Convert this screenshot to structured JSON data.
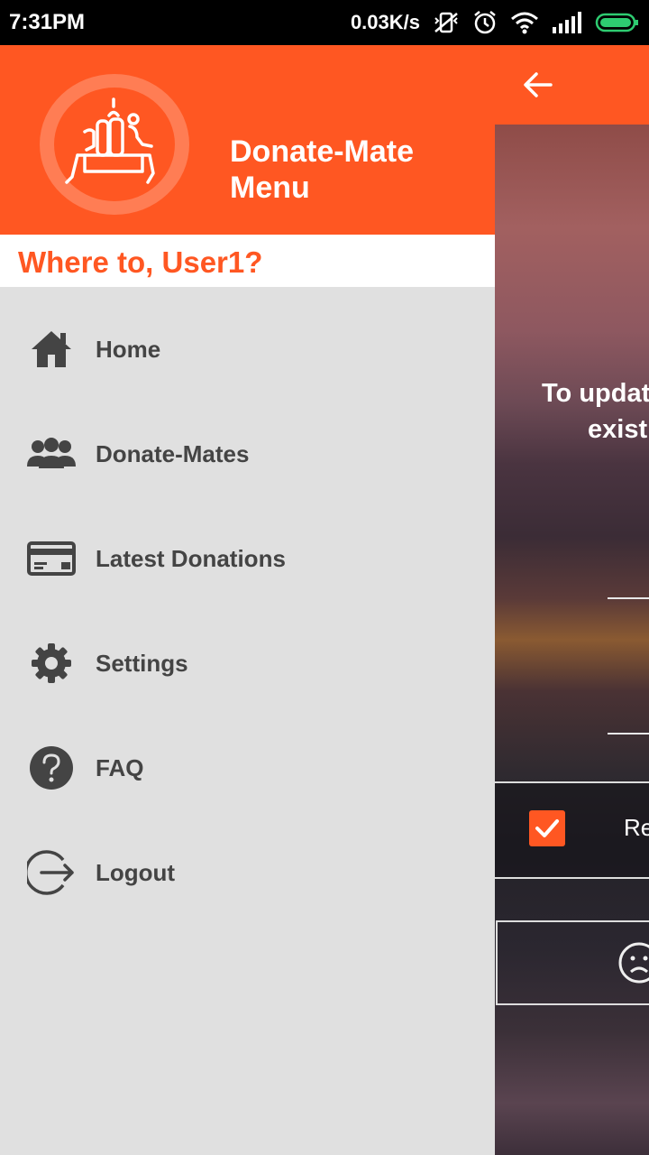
{
  "status_bar": {
    "time": "7:31PM",
    "net_speed": "0.03K/s",
    "icons": [
      "vibrate-off-icon",
      "alarm-icon",
      "wifi-icon",
      "signal-icon",
      "battery-icon"
    ]
  },
  "drawer": {
    "title": "Donate-Mate Menu",
    "title_line1": "Donate-Mate",
    "title_line2": "Menu",
    "greeting": "Where to, User1?",
    "items": [
      {
        "label": "Home",
        "icon": "home-icon"
      },
      {
        "label": "Donate-Mates",
        "icon": "group-icon"
      },
      {
        "label": "Latest Donations",
        "icon": "card-icon"
      },
      {
        "label": "Settings",
        "icon": "gear-icon"
      },
      {
        "label": "FAQ",
        "icon": "help-icon"
      },
      {
        "label": "Logout",
        "icon": "logout-icon"
      }
    ]
  },
  "background_screen": {
    "text_line1": "To updat",
    "text_line2": "exist",
    "checkbox_label": "Re"
  },
  "colors": {
    "accent": "#FF5722",
    "drawer_bg": "#E0E0E0",
    "menu_text": "#444444"
  }
}
